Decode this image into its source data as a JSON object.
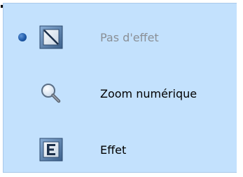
{
  "menu": {
    "items": [
      {
        "label": "Pas d'effet",
        "icon": "no-effect-icon",
        "selected": true,
        "disabled": true
      },
      {
        "label": "Zoom numérique",
        "icon": "magnifier-icon",
        "selected": false,
        "disabled": false
      },
      {
        "label": "Effet",
        "icon": "effect-icon",
        "selected": false,
        "disabled": false
      }
    ]
  },
  "colors": {
    "menu_background": "#c3e1fd",
    "menu_border": "#a9c9ea",
    "disabled_text": "#8a8f96",
    "radio_accent": "#1f5aa8"
  }
}
